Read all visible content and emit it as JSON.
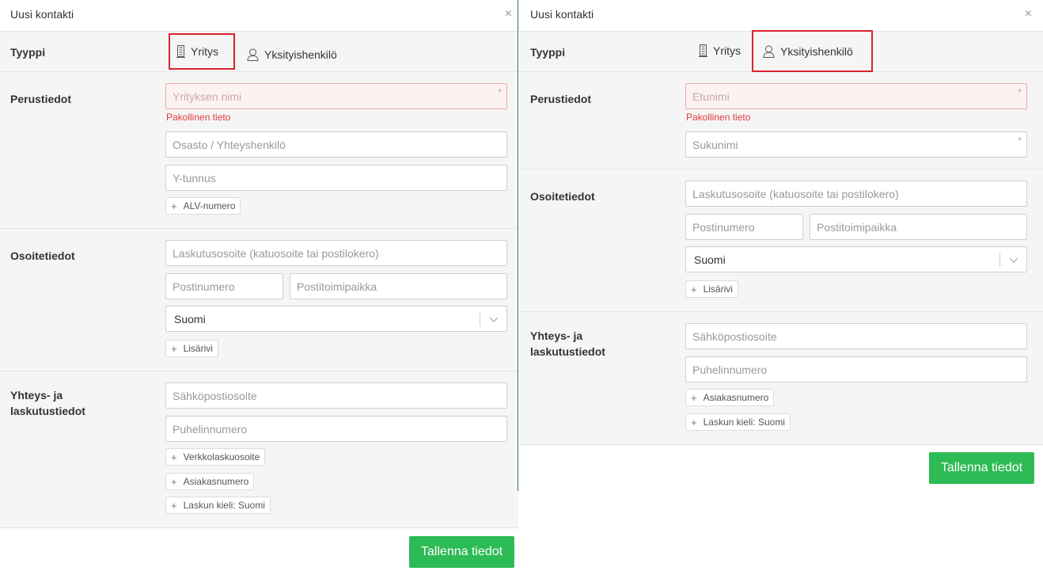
{
  "left": {
    "title": "Uusi kontakti",
    "close": "×",
    "type_label": "Tyyppi",
    "tab_company": "Yritys",
    "tab_private": "Yksityishenkilö",
    "basic_label": "Perustiedot",
    "company_name_placeholder": "Yrityksen nimi",
    "required_mark": "*",
    "required_error": "Pakollinen tieto",
    "department_placeholder": "Osasto / Yhteyshenkilö",
    "business_id_placeholder": "Y-tunnus",
    "add_vat": "ALV-numero",
    "address_label": "Osoitetiedot",
    "billing_address_placeholder": "Laskutusosoite (katuosoite tai postilokero)",
    "postal_code_placeholder": "Postinumero",
    "city_placeholder": "Postitoimipaikka",
    "country_value": "Suomi",
    "add_row": "Lisärivi",
    "contact_label_1": "Yhteys- ja",
    "contact_label_2": "laskutustiedot",
    "email_placeholder": "Sähköpostiosoite",
    "phone_placeholder": "Puhelinnumero",
    "add_einvoice": "Verkkolaskuosoite",
    "add_customer_no": "Asiakasnumero",
    "add_invoice_lang": "Laskun kieli: Suomi",
    "save": "Tallenna tiedot"
  },
  "right": {
    "title": "Uusi kontakti",
    "close": "×",
    "type_label": "Tyyppi",
    "tab_company": "Yritys",
    "tab_private": "Yksityishenkilö",
    "basic_label": "Perustiedot",
    "first_name_placeholder": "Etunimi",
    "required_mark": "*",
    "required_error": "Pakollinen tieto",
    "last_name_placeholder": "Sukunimi",
    "address_label": "Osoitetiedot",
    "billing_address_placeholder": "Laskutusosoite (katuosoite tai postilokero)",
    "postal_code_placeholder": "Postinumero",
    "city_placeholder": "Postitoimipaikka",
    "country_value": "Suomi",
    "add_row": "Lisärivi",
    "contact_label_1": "Yhteys- ja",
    "contact_label_2": "laskutustiedot",
    "email_placeholder": "Sähköpostiosoite",
    "phone_placeholder": "Puhelinnumero",
    "add_customer_no": "Asiakasnumero",
    "add_invoice_lang": "Laskun kieli: Suomi",
    "save": "Tallenna tiedot"
  },
  "colors": {
    "highlight_box": "#d9232d",
    "save_button": "#2dbb55",
    "error_text": "#e23b3b"
  },
  "icons": {
    "company_tab": "building-icon",
    "private_tab": "person-icon",
    "add": "plus-icon",
    "close": "close-icon",
    "select": "chevron-down-icon"
  }
}
